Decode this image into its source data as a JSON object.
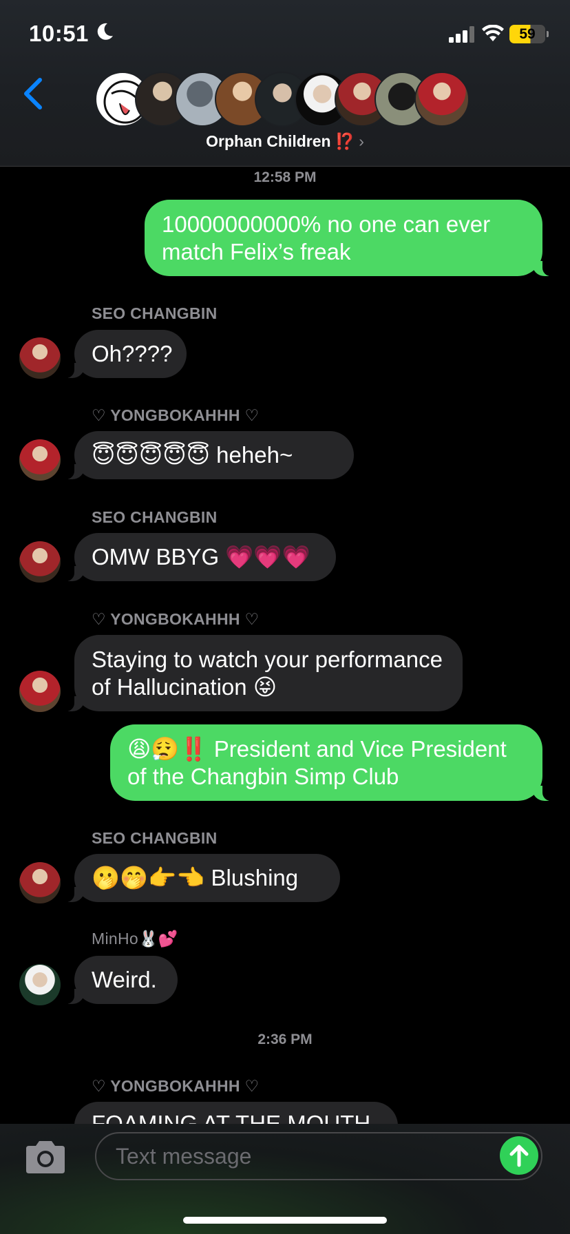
{
  "status": {
    "time": "10:51",
    "battery": "59"
  },
  "header": {
    "group_name": "Orphan Children",
    "group_mark": "⁉️",
    "chevron": "›"
  },
  "messages": [
    {
      "timestamp": "12:58 PM"
    },
    {
      "text": "10000000000% no one can ever match Felix’s freak"
    },
    {
      "sender": "SEO CHANGBIN",
      "text": "Oh????"
    },
    {
      "sender": "♡ YONGBOKAHHH ♡",
      "text": "😇😇😇😇😇 heheh~"
    },
    {
      "sender": "SEO CHANGBIN",
      "text": "OMW BBYG 💗💗💗"
    },
    {
      "sender": "♡ YONGBOKAHHH ♡",
      "text": "Staying to watch your performance of Hallucination 😝"
    },
    {
      "text": "😩😮‍💨‼️ President and Vice President of the Changbin Simp Club"
    },
    {
      "sender": "SEO CHANGBIN",
      "text": "🫢🤭👉👈 Blushing"
    },
    {
      "sender": "MinHo🐰💕",
      "text": "Weird."
    },
    {
      "timestamp": "2:36 PM"
    },
    {
      "sender": "♡ YONGBOKAHHH ♡",
      "text": "FOAMING AT THE MOUTH"
    }
  ],
  "composer": {
    "placeholder": "Text message"
  },
  "icons": {
    "back": "chevron-left-icon",
    "camera": "camera-icon",
    "send": "arrow-up-icon",
    "moon": "moon-icon",
    "signal": "cellular-signal-icon",
    "wifi": "wifi-icon",
    "battery": "battery-icon"
  },
  "colors": {
    "accent_blue": "#0a84ff",
    "outgoing_bubble": "#4cd964",
    "incoming_bubble": "#262628",
    "send_button": "#30d158",
    "battery": "#ffd60a"
  }
}
